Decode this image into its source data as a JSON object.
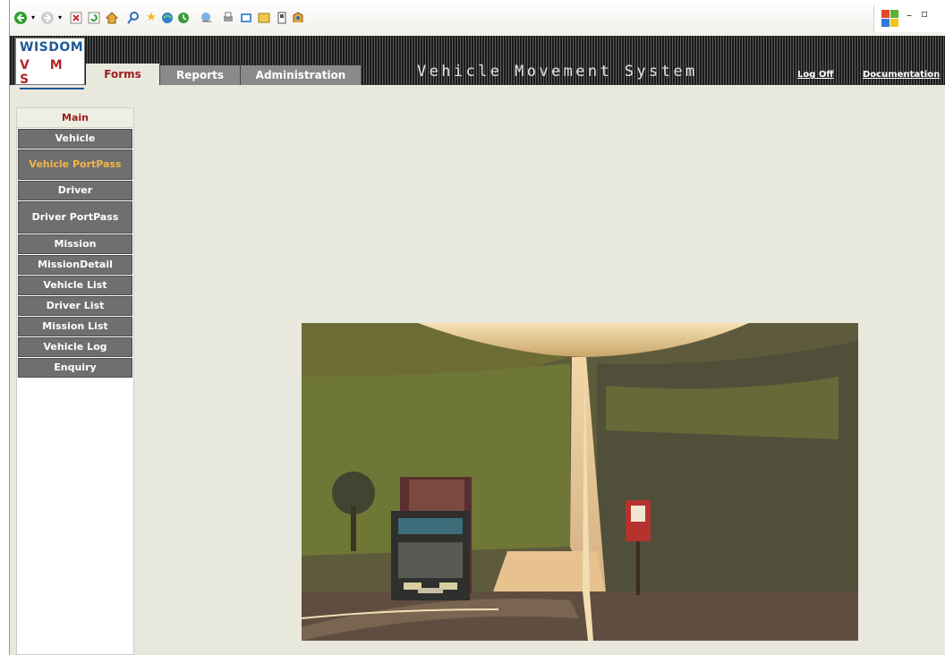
{
  "app": {
    "logo_line1": "WISDOM",
    "logo_line2": "V M S",
    "title": "Vehicle Movement System"
  },
  "header": {
    "tabs": [
      {
        "label": "Forms",
        "active": true
      },
      {
        "label": "Reports",
        "active": false
      },
      {
        "label": "Administration",
        "active": false
      }
    ],
    "links": {
      "logoff": "Log Off",
      "documentation": "Documentation"
    }
  },
  "sidebar": {
    "heading": "Main",
    "items": [
      {
        "label": "Vehicle",
        "active": false
      },
      {
        "label": "Vehicle PortPass",
        "active": true
      },
      {
        "label": "Driver",
        "active": false
      },
      {
        "label": "Driver PortPass",
        "active": false
      },
      {
        "label": "Mission",
        "active": false
      },
      {
        "label": "MissionDetail",
        "active": false
      },
      {
        "label": "Vehicle List",
        "active": false
      },
      {
        "label": "Driver List",
        "active": false
      },
      {
        "label": "Mission List",
        "active": false
      },
      {
        "label": "Vehicle Log",
        "active": false
      },
      {
        "label": "Enquiry",
        "active": false
      }
    ]
  },
  "browser_toolbar": {
    "icons": [
      "back-icon",
      "forward-icon",
      "stop-icon",
      "refresh-icon",
      "home-icon",
      "search-icon",
      "favorites-icon",
      "media-icon",
      "history-icon",
      "mail-icon",
      "print-icon",
      "edit-icon",
      "discuss-icon",
      "research-icon",
      "messenger-icon"
    ]
  },
  "colors": {
    "accent_red": "#9b1c1c",
    "active_item": "#f1b64a",
    "nav_bg": "#6f6f6f",
    "page_bg": "#e9e8dd"
  }
}
